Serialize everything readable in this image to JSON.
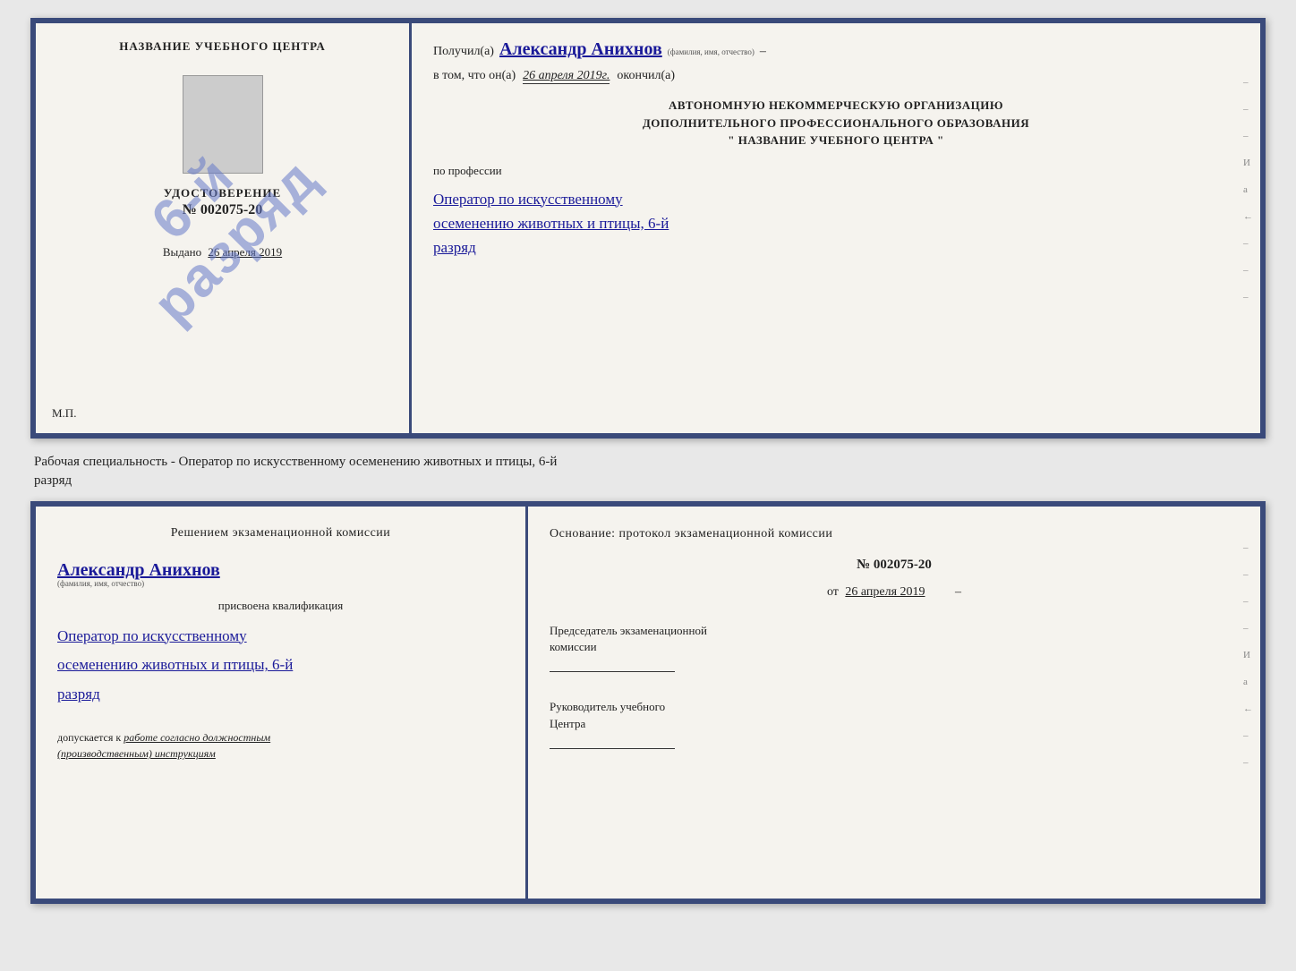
{
  "top_doc": {
    "left": {
      "school_name": "НАЗВАНИЕ УЧЕБНОГО ЦЕНТРА",
      "photo_alt": "photo",
      "udostoverenie_title": "УДОСТОВЕРЕНИЕ",
      "number": "№ 002075-20",
      "vydano_label": "Выдано",
      "vydano_date": "26 апреля 2019",
      "mp": "М.П."
    },
    "stamp": {
      "line1": "6-й",
      "line2": "разряд"
    },
    "right": {
      "poluchil_label": "Получил(а)",
      "name": "Александр Анихнов",
      "name_sub": "(фамилия, имя, отчество)",
      "dash": "–",
      "vtom_label": "в том, что он(а)",
      "date": "26 апреля 2019г.",
      "okончил": "окончил(а)",
      "org_line1": "АВТОНОМНУЮ НЕКОММЕРЧЕСКУЮ ОРГАНИЗАЦИЮ",
      "org_line2": "ДОПОЛНИТЕЛЬНОГО ПРОФЕССИОНАЛЬНОГО ОБРАЗОВАНИЯ",
      "org_line3": "\"   НАЗВАНИЕ УЧЕБНОГО ЦЕНТРА   \"",
      "po_professii": "по профессии",
      "prof_line1": "Оператор по искусственному",
      "prof_line2": "осеменению животных и птицы, 6-й",
      "prof_line3": "разряд"
    }
  },
  "between": {
    "text": "Рабочая специальность - Оператор по искусственному осеменению животных и птицы, 6-й",
    "text2": "разряд"
  },
  "bottom_doc": {
    "left": {
      "resheniem": "Решением экзаменационной комиссии",
      "name": "Александр Анихнов",
      "name_sub": "(фамилия, имя, отчество)",
      "prisvoyena": "присвоена квалификация",
      "kvali_line1": "Оператор по искусственному",
      "kvali_line2": "осеменению животных и птицы, 6-й",
      "kvali_line3": "разряд",
      "dopuskaetsya": "допускается к",
      "rabota": "работе согласно должностным",
      "instruktsii": "(производственным) инструкциям"
    },
    "right": {
      "osnovanie": "Основание: протокол экзаменационной комиссии",
      "number": "№  002075-20",
      "ot_label": "от",
      "ot_date": "26 апреля 2019",
      "predsedatel_title": "Председатель экзаменационной",
      "predsedatel_sub": "комиссии",
      "rukovoditel_title": "Руководитель учебного",
      "rukovoditel_sub": "Центра"
    }
  },
  "side_marks": {
    "marks": [
      "–",
      "–",
      "–",
      "И",
      "а",
      "←",
      "–",
      "–",
      "–"
    ]
  }
}
